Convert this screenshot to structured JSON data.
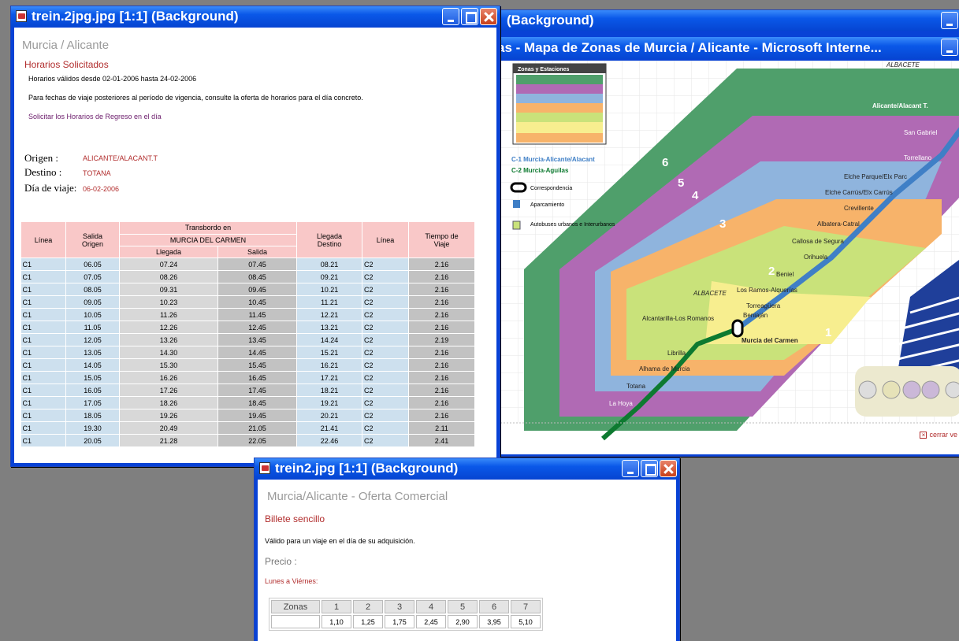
{
  "win1": {
    "title": "trein.2jpg.jpg [1:1] (Background)",
    "heading": "Murcia / Alicante",
    "section": "Horarios Solicitados",
    "valid": "Horarios válidos desde 02-01-2006 hasta 24-02-2006",
    "note": "Para fechas de viaje posteriores al período de vigencia, consulte la oferta de horarios para el día concreto.",
    "link": "Solicitar los Horarios de Regreso en el día",
    "origen_label": "Origen :",
    "origen": "ALICANTE/ALACANT.T",
    "destino_label": "Destino :",
    "destino": "TOTANA",
    "dia_label": "Día de viaje:",
    "dia": "06-02-2006",
    "th_linea": "Línea",
    "th_salida": "Salida Origen",
    "th_transbordo": "Transbordo en",
    "th_estacion": "MURCIA DEL CARMEN",
    "th_llegada": "Llegada",
    "th_salida2": "Salida",
    "th_llegada_dest": "Llegada Destino",
    "th_linea2": "Línea",
    "th_tiempo": "Tiempo de Viaje",
    "rows": [
      [
        "C1",
        "06.05",
        "07.24",
        "07.45",
        "08.21",
        "C2",
        "2.16"
      ],
      [
        "C1",
        "07.05",
        "08.26",
        "08.45",
        "09.21",
        "C2",
        "2.16"
      ],
      [
        "C1",
        "08.05",
        "09.31",
        "09.45",
        "10.21",
        "C2",
        "2.16"
      ],
      [
        "C1",
        "09.05",
        "10.23",
        "10.45",
        "11.21",
        "C2",
        "2.16"
      ],
      [
        "C1",
        "10.05",
        "11.26",
        "11.45",
        "12.21",
        "C2",
        "2.16"
      ],
      [
        "C1",
        "11.05",
        "12.26",
        "12.45",
        "13.21",
        "C2",
        "2.16"
      ],
      [
        "C1",
        "12.05",
        "13.26",
        "13.45",
        "14.24",
        "C2",
        "2.19"
      ],
      [
        "C1",
        "13.05",
        "14.30",
        "14.45",
        "15.21",
        "C2",
        "2.16"
      ],
      [
        "C1",
        "14.05",
        "15.30",
        "15.45",
        "16.21",
        "C2",
        "2.16"
      ],
      [
        "C1",
        "15.05",
        "16.26",
        "16.45",
        "17.21",
        "C2",
        "2.16"
      ],
      [
        "C1",
        "16.05",
        "17.26",
        "17.45",
        "18.21",
        "C2",
        "2.16"
      ],
      [
        "C1",
        "17.05",
        "18.26",
        "18.45",
        "19.21",
        "C2",
        "2.16"
      ],
      [
        "C1",
        "18.05",
        "19.26",
        "19.45",
        "20.21",
        "C2",
        "2.16"
      ],
      [
        "C1",
        "19.30",
        "20.49",
        "21.05",
        "21.41",
        "C2",
        "2.11"
      ],
      [
        "C1",
        "20.05",
        "21.28",
        "22.05",
        "22.46",
        "C2",
        "2.41"
      ]
    ]
  },
  "win2": {
    "title": "(Background)",
    "subtitle": "as - Mapa de Zonas de Murcia / Alicante - Microsoft Interne...",
    "legend_title": "Zonas y Estaciones",
    "legend_line1": "C-1 Murcia-Alicante/Alacant",
    "legend_line2": "C-2 Murcia-Aguilas",
    "legend_corr": "Correspondencia",
    "legend_park": "Aparcamiento",
    "legend_bus": "Autobuses urbanos e Interurbanos",
    "stations": {
      "albacete_top": "ALBACETE",
      "alicante": "Alicante/Alacant T.",
      "san_gabriel": "San Gabriel",
      "torrellano": "Torrellano",
      "elche_parque": "Elche Parque/Elx Parc",
      "elche_carrus": "Elche Carrús/Elx Carrús",
      "crevillente": "Crevillente",
      "albatera": "Albatera-Catral",
      "callosa": "Callosa de Segura",
      "orihuela": "Orihuela",
      "beniel": "Beniel",
      "ramos": "Los Ramos-Alquerías",
      "albacete_mid": "ALBACETE",
      "torreaguera": "Torreagüera",
      "beniajan": "Beniaján",
      "alcantarilla": "Alcantarilla-Los Romanos",
      "murcia": "Murcia del Carmen",
      "librilla": "Librilla",
      "alhama": "Alhama de Murcia",
      "totana": "Totana",
      "la_hoya": "La Hoya"
    },
    "zones": [
      "1",
      "2",
      "3",
      "4",
      "5",
      "6"
    ],
    "cerrar": "cerrar ve"
  },
  "win3": {
    "title": "trein2.jpg [1:1] (Background)",
    "heading": "Murcia/Alicante - Oferta Comercial",
    "ticket": "Billete sencillo",
    "desc": "Válido para un viaje en el día de su adquisición.",
    "precio": "Precio :",
    "days": "Lunes a Viérnes:",
    "zonas_label": "Zonas",
    "zones": [
      "1",
      "2",
      "3",
      "4",
      "5",
      "6",
      "7"
    ],
    "prices": [
      "1,10",
      "1,25",
      "1,75",
      "2,45",
      "2,90",
      "3,95",
      "5,10"
    ]
  },
  "colors": {
    "title_bar": "#0a58e8",
    "zone1": "#f7ee8f",
    "zone2": "#c9e27a",
    "zone3": "#f7b36a",
    "zone4": "#8fb4dd",
    "zone5": "#b06ab4",
    "zone6": "#4f9f6b",
    "line_c1": "#3f7fc6",
    "line_c2": "#0d7a30"
  }
}
